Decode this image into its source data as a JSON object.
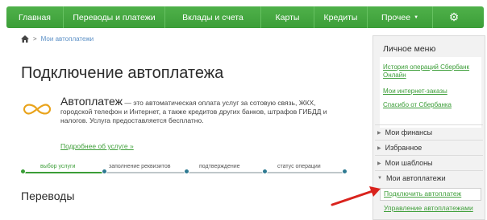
{
  "nav": {
    "items": [
      "Главная",
      "Переводы и платежи",
      "Вклады и счета",
      "Карты",
      "Кредиты",
      "Прочее"
    ],
    "more_caret_icon": "caret-down-icon",
    "settings_icon": "gear-icon",
    "color": "#43a83f"
  },
  "breadcrumb": {
    "home_icon": "home-icon",
    "current": "Мои автоплатежи"
  },
  "page": {
    "title": "Подключение автоплатежа",
    "autopay": {
      "name": "Автоплатеж",
      "description": " — это автоматическая оплата услуг за сотовую связь, ЖКХ, городской телефон и Интернет, а также кредитов других банков, штрафов ГИБДД и налогов. Услуга предоставляется бесплатно.",
      "more_link": "Подробнее об услуге »",
      "icon": "infinity-icon"
    },
    "steps": [
      "выбор услуги",
      "заполнение реквизитов",
      "подтверждение",
      "статус операции"
    ],
    "active_step": 0,
    "section_title": "Переводы"
  },
  "side_menu": {
    "title": "Личное меню",
    "links": [
      "История операций Сбербанк Онлайн",
      "Мои интернет-заказы",
      "Спасибо от Сбербанка"
    ],
    "sections": [
      "Мои финансы",
      "Избранное",
      "Мои шаблоны",
      "Мои автоплатежи"
    ],
    "subitems": [
      "Подключить автоплатеж",
      "Управление автоплатежами"
    ]
  },
  "annotation": {
    "arrow_color": "#d9231d"
  }
}
